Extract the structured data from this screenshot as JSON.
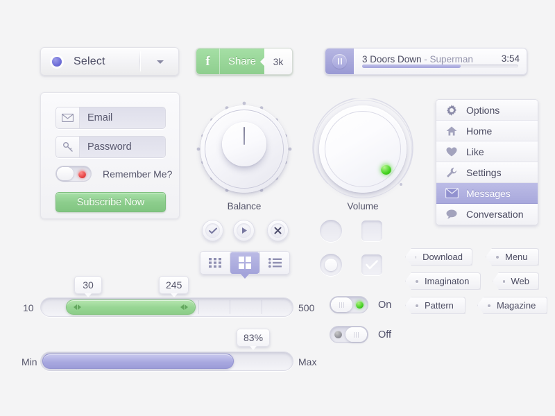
{
  "theme": {
    "background": "#f4f4f5",
    "accent_purple": "#a3a3da",
    "accent_green": "#8ccd8c",
    "led_green": "#3ecc1e",
    "led_red": "#e23b3b",
    "text": "#4a4a60"
  },
  "select": {
    "label": "Select",
    "dot_icon": "radio-dot-icon",
    "caret_icon": "chevron-down-icon"
  },
  "share": {
    "brand_icon": "facebook-f-icon",
    "brand_letter": "f",
    "label": "Share",
    "count": "3k"
  },
  "player": {
    "pause_icon": "pause-icon",
    "artist": "3 Doors Down",
    "separator": " - ",
    "song": "Superman",
    "time": "3:54",
    "progress_percent": 63
  },
  "login": {
    "email": {
      "placeholder": "Email",
      "icon": "envelope-icon"
    },
    "password": {
      "placeholder": "Password",
      "icon": "key-icon"
    },
    "remember": {
      "label": "Remember Me?",
      "state": "off",
      "led": "red"
    },
    "subscribe_label": "Subscribe Now"
  },
  "knobs": [
    {
      "name": "balance",
      "label": "Balance",
      "marks": 16,
      "pointer_angle": 0
    },
    {
      "name": "volume",
      "label": "Volume",
      "indicator": "green-led",
      "indicator_angle": 135
    }
  ],
  "round_buttons": [
    {
      "name": "confirm",
      "icon": "check-icon"
    },
    {
      "name": "play",
      "icon": "play-icon"
    },
    {
      "name": "close",
      "icon": "close-x-icon"
    }
  ],
  "segmented": {
    "options": [
      {
        "name": "small-grid",
        "icon": "grid-small-icon",
        "active": false
      },
      {
        "name": "large-grid",
        "icon": "grid-large-icon",
        "active": true
      },
      {
        "name": "list",
        "icon": "list-icon",
        "active": false
      }
    ]
  },
  "choices": {
    "radio_off": "radio-unselected",
    "radio_on": "radio-selected",
    "checkbox_off": "checkbox-unchecked",
    "checkbox_on": "checkbox-checked"
  },
  "tags": [
    {
      "label": "Download"
    },
    {
      "label": "Menu"
    },
    {
      "label": "Imaginaton"
    },
    {
      "label": "Web"
    },
    {
      "label": "Pattern"
    },
    {
      "label": "Magazine"
    }
  ],
  "range_slider": {
    "min_label": "10",
    "max_label": "500",
    "min": 10,
    "max": 500,
    "low_value": "30",
    "high_value": "245",
    "low": 30,
    "high": 245,
    "tick_count": 8
  },
  "progress_slider": {
    "min_label": "Min",
    "max_label": "Max",
    "value_label": "83%",
    "value": 83
  },
  "toggles": [
    {
      "label": "On",
      "state": "on",
      "led": "green"
    },
    {
      "label": "Off",
      "state": "off",
      "led": "grey"
    }
  ],
  "menu": {
    "items": [
      {
        "label": "Options",
        "icon": "gear-icon",
        "active": false
      },
      {
        "label": "Home",
        "icon": "home-icon",
        "active": false
      },
      {
        "label": "Like",
        "icon": "heart-icon",
        "active": false
      },
      {
        "label": "Settings",
        "icon": "wrench-icon",
        "active": false
      },
      {
        "label": "Messages",
        "icon": "envelope-icon",
        "active": true
      },
      {
        "label": "Conversation",
        "icon": "speech-bubble-icon",
        "active": false
      }
    ]
  }
}
